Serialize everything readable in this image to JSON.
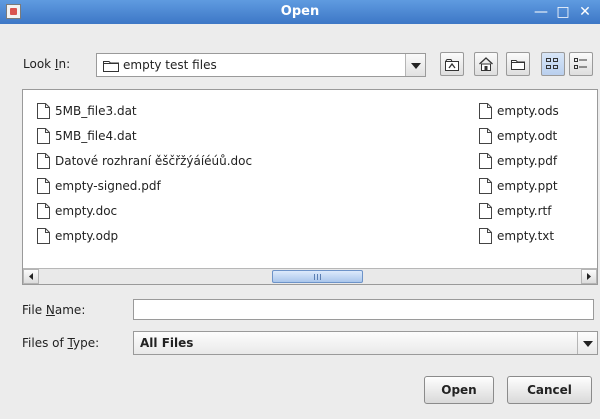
{
  "window": {
    "title": "Open",
    "controls": {
      "minimize": "—",
      "maximize": "□",
      "close": "✕"
    }
  },
  "look_in": {
    "label_prefix": "Look ",
    "label_mnemonic": "I",
    "label_suffix": "n:",
    "value": "empty test files",
    "toolbar": [
      "up-one-level-icon",
      "home-icon",
      "new-folder-icon",
      "list-view-icon",
      "details-view-icon"
    ]
  },
  "files": [
    {
      "name": "5MB_file3.dat"
    },
    {
      "name": "5MB_file4.dat"
    },
    {
      "name": "Datové rozhraní ěščřžýáíéúů.doc"
    },
    {
      "name": "empty-signed.pdf"
    },
    {
      "name": "empty.doc"
    },
    {
      "name": "empty.odp"
    },
    {
      "name": "empty.ods"
    },
    {
      "name": "empty.odt"
    },
    {
      "name": "empty.pdf"
    },
    {
      "name": "empty.ppt"
    },
    {
      "name": "empty.rtf"
    },
    {
      "name": "empty.txt"
    }
  ],
  "file_name": {
    "label_prefix": "File ",
    "label_mnemonic": "N",
    "label_suffix": "ame:",
    "value": ""
  },
  "files_of_type": {
    "label_prefix": "Files of ",
    "label_mnemonic": "T",
    "label_suffix": "ype:",
    "value": "All Files"
  },
  "buttons": {
    "open": "Open",
    "cancel": "Cancel"
  },
  "colors": {
    "titlebar": "#4a86d4",
    "thumb": "#aac6ec"
  }
}
